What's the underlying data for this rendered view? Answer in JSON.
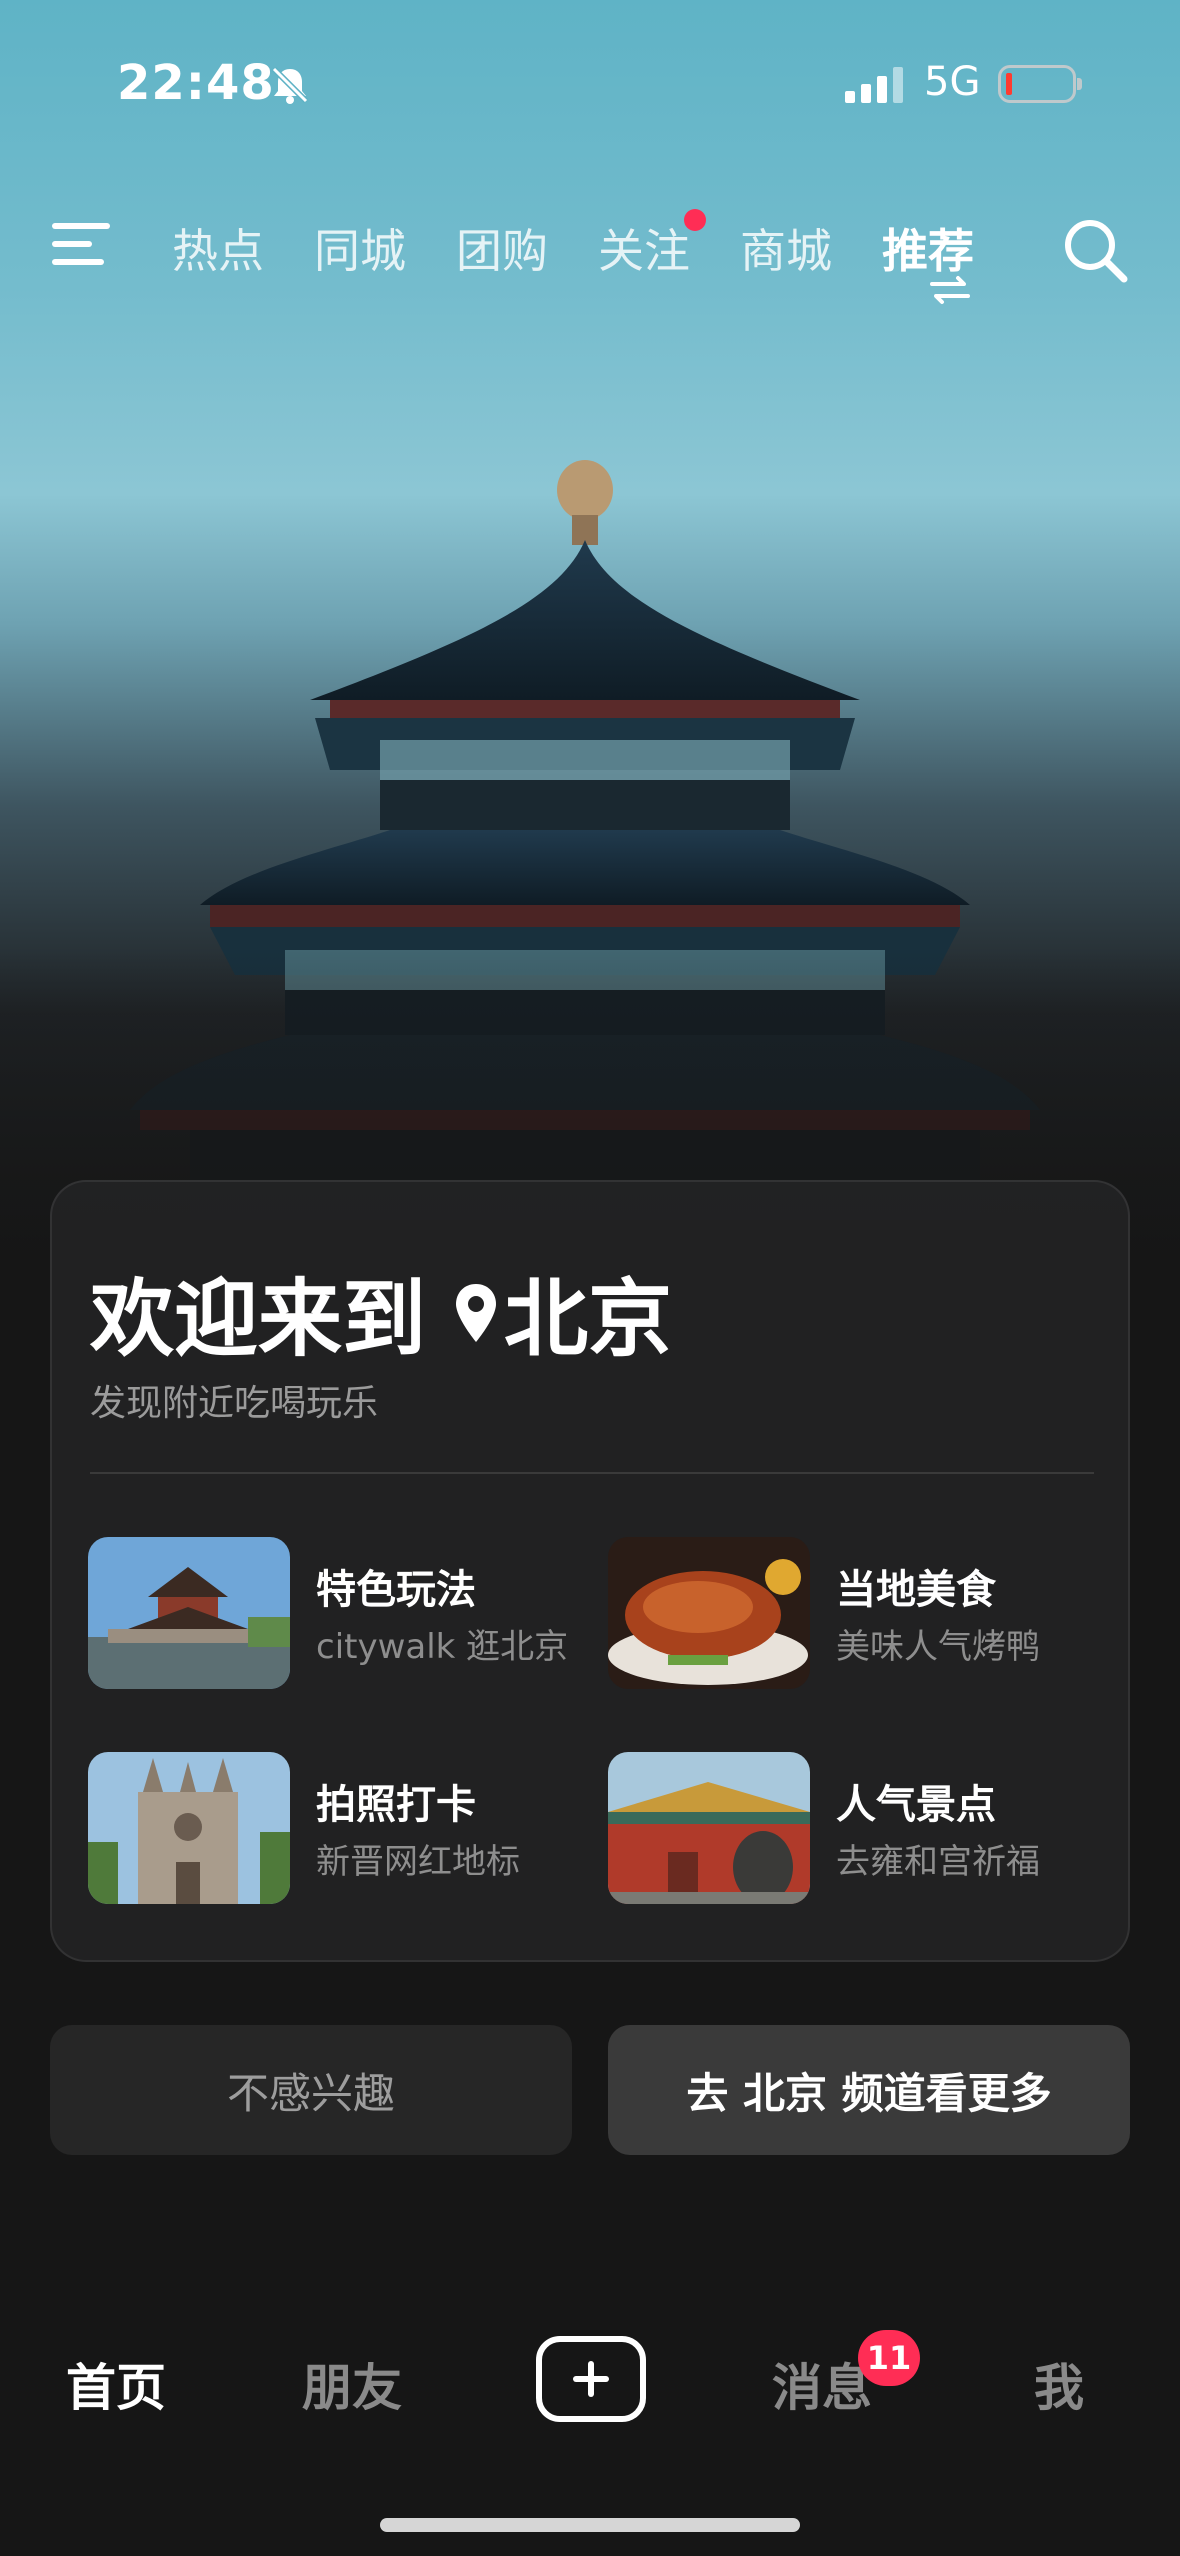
{
  "status_bar": {
    "time": "22:48",
    "network": "5G",
    "battery_color": "#ff3b30"
  },
  "top_nav": {
    "tabs": [
      {
        "label": "热点",
        "has_dot": false
      },
      {
        "label": "同城",
        "has_dot": false
      },
      {
        "label": "团购",
        "has_dot": false
      },
      {
        "label": "关注",
        "has_dot": true
      },
      {
        "label": "商城",
        "has_dot": false
      },
      {
        "label": "推荐",
        "has_dot": false,
        "active": true
      }
    ],
    "icons": [
      "menu-icon",
      "swap-icon",
      "search-icon"
    ]
  },
  "card": {
    "welcome": "欢迎来到",
    "city": "北京",
    "subtitle": "发现附近吃喝玩乐",
    "items": [
      {
        "title": "特色玩法",
        "subtitle": "citywalk 逛北京"
      },
      {
        "title": "当地美食",
        "subtitle": "美味人气烤鸭"
      },
      {
        "title": "拍照打卡",
        "subtitle": "新晋网红地标"
      },
      {
        "title": "人气景点",
        "subtitle": "去雍和宫祈福"
      }
    ]
  },
  "actions": {
    "not_interested": "不感兴趣",
    "go_channel": "去 北京 频道看更多"
  },
  "bottom_nav": {
    "home": "首页",
    "friends": "朋友",
    "messages": "消息",
    "messages_badge": "11",
    "me": "我"
  },
  "colors": {
    "accent": "#ff2d55",
    "background": "#161616",
    "card": "#222223"
  }
}
